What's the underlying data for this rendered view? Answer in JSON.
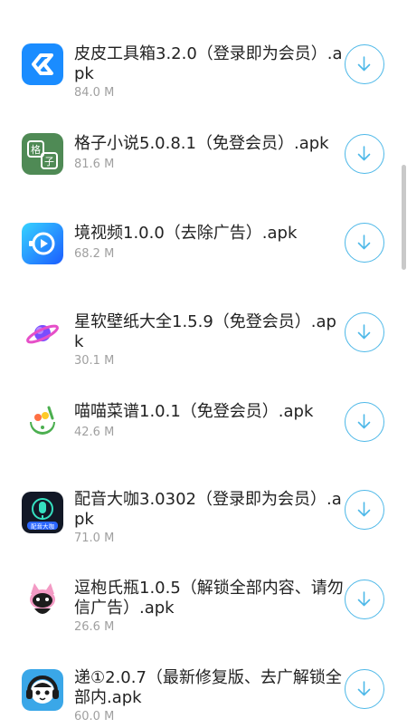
{
  "items": [
    {
      "title": "皮皮工具箱3.2.0（登录即为会员）.apk",
      "size": "84.0 M",
      "icon": "pipi-toolbox-icon"
    },
    {
      "title": "格子小说5.0.8.1（免登会员）.apk",
      "size": "81.6 M",
      "icon": "gezi-novel-icon"
    },
    {
      "title": "境视频1.0.0（去除广告）.apk",
      "size": "68.2 M",
      "icon": "jing-video-icon"
    },
    {
      "title": "星软壁纸大全1.5.9（免登会员）.apk",
      "size": "30.1 M",
      "icon": "planet-wallpaper-icon"
    },
    {
      "title": "喵喵菜谱1.0.1（免登会员）.apk",
      "size": "42.6 M",
      "icon": "recipe-bowl-icon"
    },
    {
      "title": "配音大咖3.0302（登录即为会员）.apk",
      "size": "71.0 M",
      "icon": "dubbing-mic-icon"
    },
    {
      "title": "逗枹氏瓶1.0.5（解锁全部内容、请勿信广告）.apk",
      "size": "26.6 M",
      "icon": "cat-character-icon"
    },
    {
      "title": "递①2.0.7（最新修复版、去广解锁全部内.apk",
      "size": "60.0 M",
      "icon": "headphone-character-icon"
    }
  ],
  "icon_texts": {
    "gezi": "格子",
    "dubbing": "配音大咖"
  },
  "download_icon": "download-arrow-icon",
  "colors": {
    "accent": "#4db8e8",
    "title_text": "#222222",
    "size_text": "#a0a0a0"
  }
}
